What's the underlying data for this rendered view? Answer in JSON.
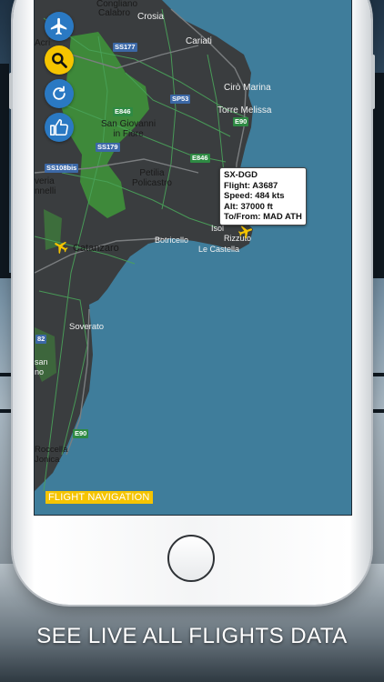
{
  "map": {
    "towns": [
      {
        "id": "congliano",
        "label": "Congliano"
      },
      {
        "id": "calabro",
        "label": "Calabro"
      },
      {
        "id": "crosia",
        "label": "Crosia"
      },
      {
        "id": "acri",
        "label": "Acri"
      },
      {
        "id": "cariati",
        "label": "Cariati"
      },
      {
        "id": "ciro-marina",
        "label": "Cirò Marina"
      },
      {
        "id": "torre-melissa",
        "label": "Torre Melissa"
      },
      {
        "id": "san-giovanni",
        "label": "San Giovanni\nin Fiore"
      },
      {
        "id": "petilia",
        "label": "Petilia\nPolicastro"
      },
      {
        "id": "veria",
        "label": "veria\nnnelli"
      },
      {
        "id": "catanzaro",
        "label": "Catanzaro"
      },
      {
        "id": "botricello",
        "label": "Botricello"
      },
      {
        "id": "le-castella",
        "label": "Le Castella"
      },
      {
        "id": "isola",
        "label": "Isol"
      },
      {
        "id": "rizzuto",
        "label": "Rizzuto"
      },
      {
        "id": "soverato",
        "label": "Soverato"
      },
      {
        "id": "san",
        "label": "san\nno"
      },
      {
        "id": "roccella",
        "label": "Roccella\nJonica"
      }
    ],
    "roads": [
      {
        "id": "ss177",
        "label": "SS177"
      },
      {
        "id": "sp53",
        "label": "SP53"
      },
      {
        "id": "e90-top",
        "label": "E90"
      },
      {
        "id": "e846-a",
        "label": "E846"
      },
      {
        "id": "ss179",
        "label": "SS179"
      },
      {
        "id": "e846-b",
        "label": "E846"
      },
      {
        "id": "ss108bis",
        "label": "SS108bis"
      },
      {
        "id": "r82",
        "label": "82"
      },
      {
        "id": "e90-bottom",
        "label": "E90"
      }
    ]
  },
  "popup": {
    "registration": "SX-DGD",
    "flight": "Flight: A3687",
    "speed": "Speed: 484 kts",
    "altitude": "Alt: 37000 ft",
    "route": "To/From: MAD ATH"
  },
  "nav_label": "FLIGHT NAVIGATION",
  "tagline": "SEE LIVE ALL FLIGHTS DATA",
  "colors": {
    "sea": "#3f7d9b",
    "land": "#3a3d3f",
    "forest": "#3f8f3a",
    "accent_yellow": "#f5c400",
    "fab_blue": "#2a79c3"
  },
  "icons": [
    "airplane-icon",
    "search-icon",
    "refresh-icon",
    "thumbs-up-icon",
    "plane-marker-icon"
  ]
}
